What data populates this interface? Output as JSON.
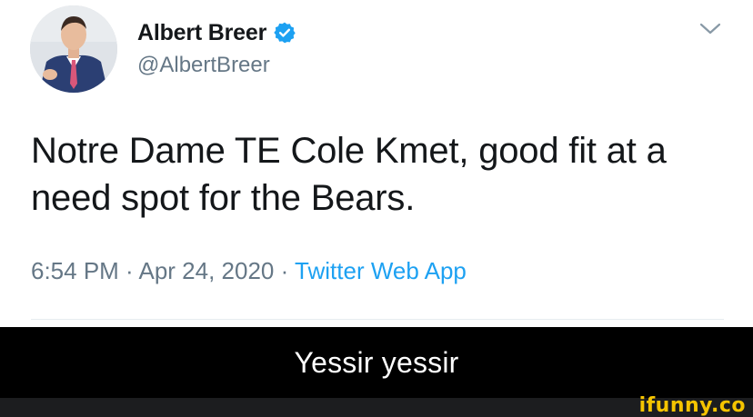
{
  "tweet": {
    "display_name": "Albert Breer",
    "handle": "@AlbertBreer",
    "verified": true,
    "text": "Notre Dame TE Cole Kmet, good fit at a need spot for the Bears.",
    "time": "6:54 PM",
    "date": "Apr 24, 2020",
    "separator": " · ",
    "source": "Twitter Web App",
    "icons": {
      "verified": "verified-badge-icon",
      "menu": "chevron-down-icon"
    }
  },
  "caption": {
    "text": "Yessir yessir"
  },
  "watermark": {
    "text": "ifunny.co"
  },
  "colors": {
    "text_primary": "#14171a",
    "text_secondary": "#657786",
    "link": "#1da1f2",
    "verified": "#1da1f2",
    "caption_bg": "#000000",
    "watermark": "#f5c400"
  }
}
